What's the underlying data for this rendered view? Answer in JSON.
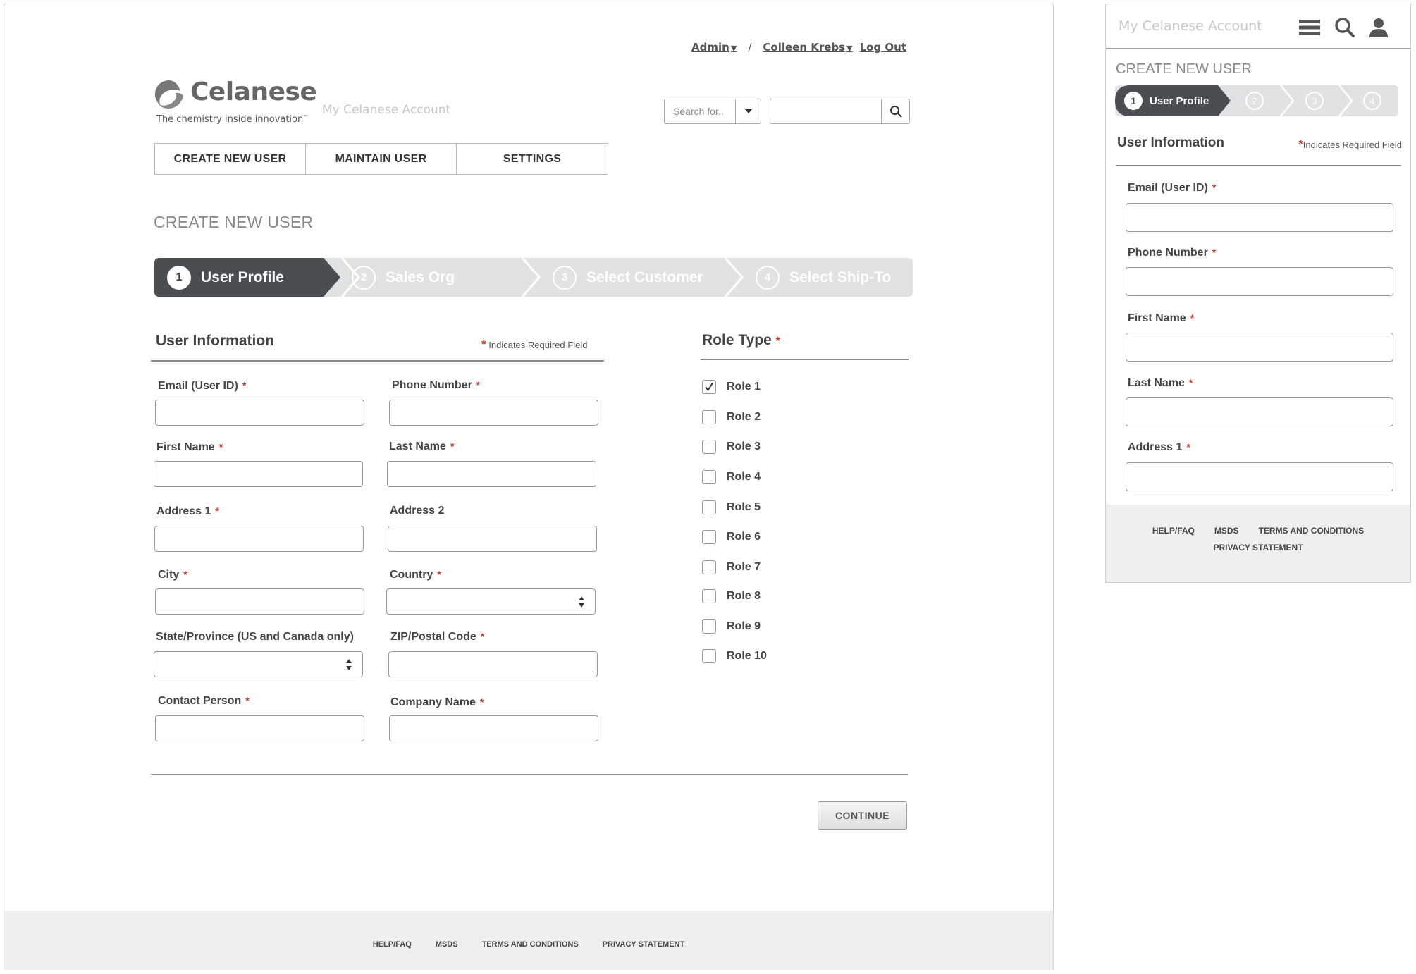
{
  "header": {
    "admin_label": "Admin",
    "separator": "/",
    "user_name": "Colleen Krebs",
    "logout_label": "Log Out",
    "logo_word": "Celanese",
    "logo_tagline": "The chemistry inside innovation",
    "logo_tm": "™",
    "site_name": "My Celanese Account",
    "search_scope_placeholder": "Search for..",
    "search_value": ""
  },
  "nav": {
    "tabs": [
      {
        "label": "CREATE NEW USER"
      },
      {
        "label": "MAINTAIN USER"
      },
      {
        "label": "SETTINGS"
      }
    ]
  },
  "page": {
    "title": "CREATE NEW USER"
  },
  "stepper": {
    "active_index": 0,
    "steps": [
      {
        "num": "1",
        "label": "User Profile"
      },
      {
        "num": "2",
        "label": "Sales Org"
      },
      {
        "num": "3",
        "label": "Select Customer"
      },
      {
        "num": "4",
        "label": "Select Ship-To"
      }
    ]
  },
  "user_info": {
    "heading": "User Information",
    "required_star": "*",
    "required_note": "Indicates Required Field",
    "fields": [
      {
        "label": "Email (User ID)",
        "required": true,
        "value": ""
      },
      {
        "label": "Phone Number",
        "required": true,
        "value": ""
      },
      {
        "label": "First Name",
        "required": true,
        "value": ""
      },
      {
        "label": "Last Name",
        "required": true,
        "value": ""
      },
      {
        "label": "Address 1",
        "required": true,
        "value": ""
      },
      {
        "label": "Address 2",
        "required": false,
        "value": ""
      },
      {
        "label": "City",
        "required": true,
        "value": ""
      },
      {
        "label": "Country",
        "required": true,
        "value": "",
        "type": "select"
      },
      {
        "label": "State/Province (US and Canada only)",
        "required": false,
        "value": "",
        "type": "select"
      },
      {
        "label": "ZIP/Postal Code",
        "required": true,
        "value": ""
      },
      {
        "label": "Contact Person",
        "required": true,
        "value": ""
      },
      {
        "label": "Company Name",
        "required": true,
        "value": ""
      }
    ]
  },
  "role_type": {
    "heading": "Role Type",
    "required_star": "*",
    "roles": [
      {
        "label": "Role 1",
        "checked": true
      },
      {
        "label": "Role 2",
        "checked": false
      },
      {
        "label": "Role 3",
        "checked": false
      },
      {
        "label": "Role 4",
        "checked": false
      },
      {
        "label": "Role 5",
        "checked": false
      },
      {
        "label": "Role 6",
        "checked": false
      },
      {
        "label": "Role 7",
        "checked": false
      },
      {
        "label": "Role 8",
        "checked": false
      },
      {
        "label": "Role 9",
        "checked": false
      },
      {
        "label": "Role 10",
        "checked": false
      }
    ]
  },
  "actions": {
    "continue_label": "CONTINUE"
  },
  "footer": {
    "links": [
      "HELP/FAQ",
      "MSDS",
      "TERMS AND CONDITIONS",
      "PRIVACY STATEMENT"
    ]
  },
  "mobile": {
    "site_name": "My Celanese Account",
    "title": "CREATE NEW USER",
    "active_step_num": "1",
    "active_step_label": "User Profile",
    "other_steps": [
      "2",
      "3",
      "4"
    ],
    "heading": "User Information",
    "required_star": "*",
    "required_note": "Indicates Required Field",
    "fields": [
      {
        "label": "Email (User ID)",
        "required": true,
        "value": ""
      },
      {
        "label": "Phone Number",
        "required": true,
        "value": ""
      },
      {
        "label": "First Name",
        "required": true,
        "value": ""
      },
      {
        "label": "Last Name",
        "required": true,
        "value": ""
      },
      {
        "label": "Address 1",
        "required": true,
        "value": ""
      }
    ],
    "footer_links": [
      "HELP/FAQ",
      "MSDS",
      "TERMS AND CONDITIONS"
    ],
    "footer_links_row2": [
      "PRIVACY STATEMENT"
    ]
  },
  "colors": {
    "stepper_active": "#4a4d52",
    "stepper_inactive": "#e1e2e4",
    "required_star": "#c0392b",
    "footer_bg": "#efefef"
  },
  "icons": {
    "logo": "celanese-swirl-icon",
    "search": "search-icon",
    "dropdown": "chevron-down-icon",
    "menu": "hamburger-menu-icon",
    "user": "user-icon",
    "check": "check-icon",
    "select_arrows": "updown-arrows-icon"
  }
}
